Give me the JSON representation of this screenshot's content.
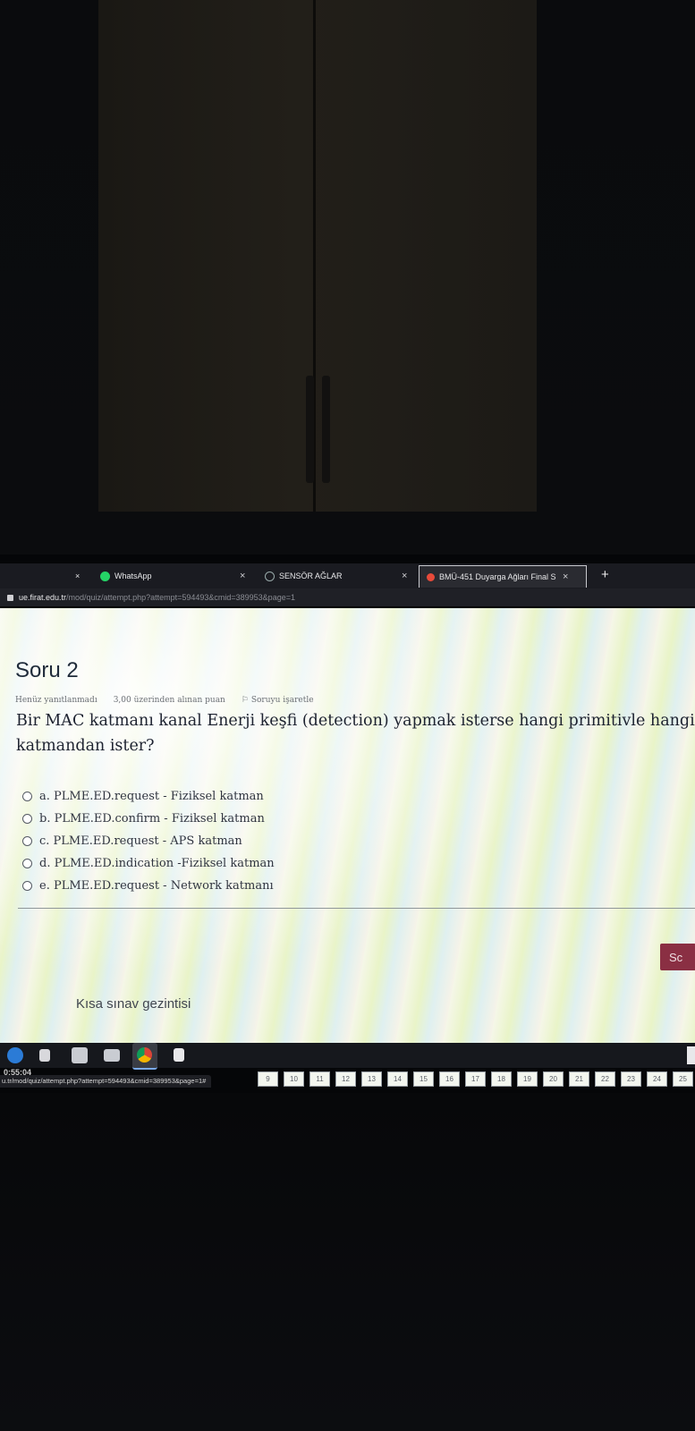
{
  "browser": {
    "tabs": [
      {
        "label": "WhatsApp",
        "close": "×"
      },
      {
        "label": "SENSÖR AĞLAR",
        "close": "×"
      },
      {
        "label": "BMÜ-451 Duyarga Ağları Final S",
        "close": "×"
      }
    ],
    "leading_close": "×",
    "new_tab": "+",
    "url_host": "ue.firat.edu.tr",
    "url_path": "/mod/quiz/attempt.php?attempt=594493&cmid=389953&page=1",
    "status_url": "u.tr/mod/quiz/attempt.php?attempt=594493&cmid=389953&page=1#"
  },
  "question": {
    "title": "Soru 2",
    "status": "Henüz yanıtlanmadı",
    "points": "3,00 üzerinden alınan puan",
    "flag": "Soruyu işaretle",
    "text": "Bir MAC katmanı kanal Enerji keşfi (detection) yapmak isterse hangi primitivle hangi katmandan ister?",
    "answers": [
      "a. PLME.ED.request - Fiziksel katman",
      "b. PLME.ED.confirm - Fiziksel katman",
      "c. PLME.ED.request - APS katman",
      "d. PLME.ED.indication -Fiziksel katman",
      "e. PLME.ED.request - Network katmanı"
    ]
  },
  "next_button": "Sc",
  "quiz_nav": {
    "title": "Kısa sınav gezintisi",
    "pages": [
      "9",
      "10",
      "11",
      "12",
      "13",
      "14",
      "15",
      "16",
      "17",
      "18",
      "19",
      "20",
      "21",
      "22",
      "23",
      "24",
      "25"
    ]
  },
  "timer": "0:55:04",
  "colors": {
    "accent": "#8a2f43",
    "tab_bar": "#1a1b21",
    "title": "#1f2b3a"
  }
}
